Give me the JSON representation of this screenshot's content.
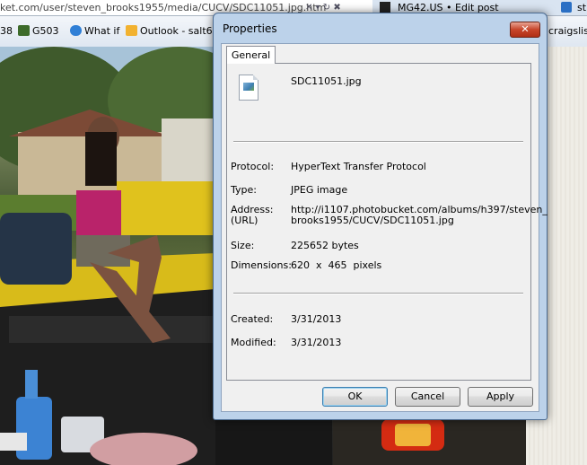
{
  "browser": {
    "address_url": "ket.com/user/steven_brooks1955/media/CUCV/SDC11051.jpg.htm",
    "address_controls": "✕ ▾ ↻ ✖",
    "tabs": [
      {
        "label": "MG42.US • Edit post"
      },
      {
        "label": "st"
      }
    ],
    "favorites": [
      {
        "label": "38",
        "icon": "number-fragment"
      },
      {
        "label": "G503",
        "icon": "jeep-icon"
      },
      {
        "label": "What if",
        "icon": "ie-icon"
      },
      {
        "label": "Outlook - salt6",
        "icon": "outlook-icon"
      },
      {
        "label": "craigslis",
        "icon": "craigslist-icon"
      }
    ]
  },
  "dialog": {
    "title": "Properties",
    "close_label": "✕",
    "tab_label": "General",
    "file_name": "SDC11051.jpg",
    "fields": {
      "protocol_label": "Protocol:",
      "protocol_value": "HyperText Transfer Protocol",
      "type_label": "Type:",
      "type_value": "JPEG image",
      "address_label_1": "Address:",
      "address_label_2": "(URL)",
      "address_value_1": "http://i1107.photobucket.com/albums/h397/steven_",
      "address_value_2": "brooks1955/CUCV/SDC11051.jpg",
      "size_label": "Size:",
      "size_value": "225652 bytes",
      "dimensions_label": "Dimensions:",
      "dimensions_value": "620  x  465  pixels",
      "created_label": "Created:",
      "created_value": "3/31/2013",
      "modified_label": "Modified:",
      "modified_value": "3/31/2013"
    },
    "buttons": {
      "ok": "OK",
      "cancel": "Cancel",
      "apply": "Apply"
    }
  },
  "colors": {
    "dialog_frame": "#bcd2ea",
    "close_button": "#c7452a",
    "client_bg": "#f0f0f0"
  }
}
